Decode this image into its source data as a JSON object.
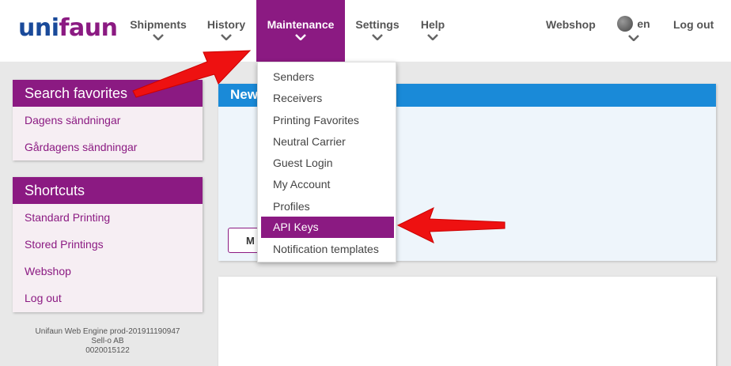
{
  "logo": {
    "part1": "uni",
    "part2": "faun"
  },
  "colors": {
    "brand": "#8b1a82",
    "logo_blue": "#1a4a9a",
    "accent_blue": "#1a8ad8",
    "arrow": "#ee1111"
  },
  "nav": {
    "items": [
      {
        "label": "Shipments"
      },
      {
        "label": "History"
      },
      {
        "label": "Maintenance"
      },
      {
        "label": "Settings"
      },
      {
        "label": "Help"
      }
    ],
    "webshop": "Webshop",
    "language": "en",
    "logout": "Log out"
  },
  "maintenance_menu": [
    "Senders",
    "Receivers",
    "Printing Favorites",
    "Neutral Carrier",
    "Guest Login",
    "My Account",
    "Profiles",
    "API Keys",
    "Notification templates"
  ],
  "search_favorites": {
    "title": "Search favorites",
    "items": [
      "Dagens sändningar",
      "Gårdagens sändningar"
    ]
  },
  "shortcuts": {
    "title": "Shortcuts",
    "items": [
      "Standard Printing",
      "Stored Printings",
      "Webshop",
      "Log out"
    ]
  },
  "footer": {
    "version": "Unifaun Web Engine prod-201911190947",
    "company": "Sell-o AB",
    "number": "0020015122"
  },
  "main_card": {
    "title": "New",
    "button_label": "M"
  }
}
